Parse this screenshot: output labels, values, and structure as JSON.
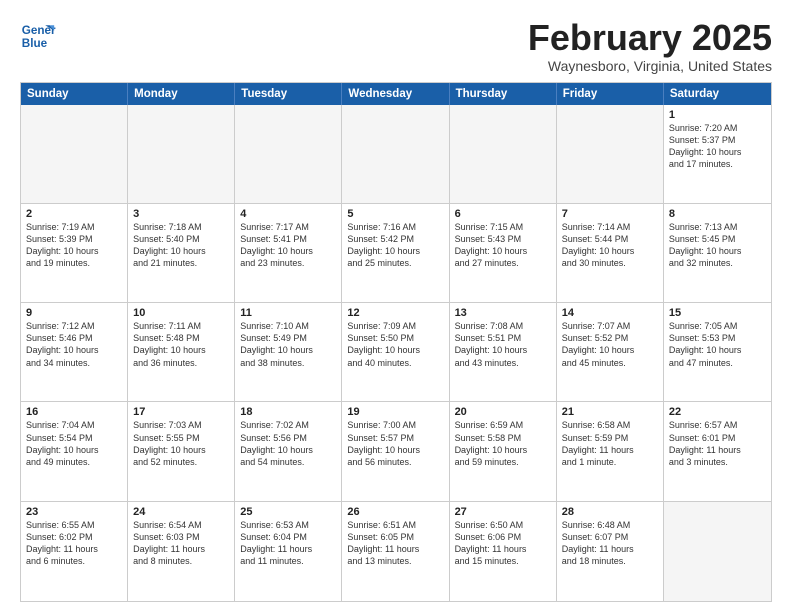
{
  "header": {
    "logo_line1": "General",
    "logo_line2": "Blue",
    "month": "February 2025",
    "location": "Waynesboro, Virginia, United States"
  },
  "weekdays": [
    "Sunday",
    "Monday",
    "Tuesday",
    "Wednesday",
    "Thursday",
    "Friday",
    "Saturday"
  ],
  "weeks": [
    [
      {
        "day": "",
        "info": ""
      },
      {
        "day": "",
        "info": ""
      },
      {
        "day": "",
        "info": ""
      },
      {
        "day": "",
        "info": ""
      },
      {
        "day": "",
        "info": ""
      },
      {
        "day": "",
        "info": ""
      },
      {
        "day": "1",
        "info": "Sunrise: 7:20 AM\nSunset: 5:37 PM\nDaylight: 10 hours\nand 17 minutes."
      }
    ],
    [
      {
        "day": "2",
        "info": "Sunrise: 7:19 AM\nSunset: 5:39 PM\nDaylight: 10 hours\nand 19 minutes."
      },
      {
        "day": "3",
        "info": "Sunrise: 7:18 AM\nSunset: 5:40 PM\nDaylight: 10 hours\nand 21 minutes."
      },
      {
        "day": "4",
        "info": "Sunrise: 7:17 AM\nSunset: 5:41 PM\nDaylight: 10 hours\nand 23 minutes."
      },
      {
        "day": "5",
        "info": "Sunrise: 7:16 AM\nSunset: 5:42 PM\nDaylight: 10 hours\nand 25 minutes."
      },
      {
        "day": "6",
        "info": "Sunrise: 7:15 AM\nSunset: 5:43 PM\nDaylight: 10 hours\nand 27 minutes."
      },
      {
        "day": "7",
        "info": "Sunrise: 7:14 AM\nSunset: 5:44 PM\nDaylight: 10 hours\nand 30 minutes."
      },
      {
        "day": "8",
        "info": "Sunrise: 7:13 AM\nSunset: 5:45 PM\nDaylight: 10 hours\nand 32 minutes."
      }
    ],
    [
      {
        "day": "9",
        "info": "Sunrise: 7:12 AM\nSunset: 5:46 PM\nDaylight: 10 hours\nand 34 minutes."
      },
      {
        "day": "10",
        "info": "Sunrise: 7:11 AM\nSunset: 5:48 PM\nDaylight: 10 hours\nand 36 minutes."
      },
      {
        "day": "11",
        "info": "Sunrise: 7:10 AM\nSunset: 5:49 PM\nDaylight: 10 hours\nand 38 minutes."
      },
      {
        "day": "12",
        "info": "Sunrise: 7:09 AM\nSunset: 5:50 PM\nDaylight: 10 hours\nand 40 minutes."
      },
      {
        "day": "13",
        "info": "Sunrise: 7:08 AM\nSunset: 5:51 PM\nDaylight: 10 hours\nand 43 minutes."
      },
      {
        "day": "14",
        "info": "Sunrise: 7:07 AM\nSunset: 5:52 PM\nDaylight: 10 hours\nand 45 minutes."
      },
      {
        "day": "15",
        "info": "Sunrise: 7:05 AM\nSunset: 5:53 PM\nDaylight: 10 hours\nand 47 minutes."
      }
    ],
    [
      {
        "day": "16",
        "info": "Sunrise: 7:04 AM\nSunset: 5:54 PM\nDaylight: 10 hours\nand 49 minutes."
      },
      {
        "day": "17",
        "info": "Sunrise: 7:03 AM\nSunset: 5:55 PM\nDaylight: 10 hours\nand 52 minutes."
      },
      {
        "day": "18",
        "info": "Sunrise: 7:02 AM\nSunset: 5:56 PM\nDaylight: 10 hours\nand 54 minutes."
      },
      {
        "day": "19",
        "info": "Sunrise: 7:00 AM\nSunset: 5:57 PM\nDaylight: 10 hours\nand 56 minutes."
      },
      {
        "day": "20",
        "info": "Sunrise: 6:59 AM\nSunset: 5:58 PM\nDaylight: 10 hours\nand 59 minutes."
      },
      {
        "day": "21",
        "info": "Sunrise: 6:58 AM\nSunset: 5:59 PM\nDaylight: 11 hours\nand 1 minute."
      },
      {
        "day": "22",
        "info": "Sunrise: 6:57 AM\nSunset: 6:01 PM\nDaylight: 11 hours\nand 3 minutes."
      }
    ],
    [
      {
        "day": "23",
        "info": "Sunrise: 6:55 AM\nSunset: 6:02 PM\nDaylight: 11 hours\nand 6 minutes."
      },
      {
        "day": "24",
        "info": "Sunrise: 6:54 AM\nSunset: 6:03 PM\nDaylight: 11 hours\nand 8 minutes."
      },
      {
        "day": "25",
        "info": "Sunrise: 6:53 AM\nSunset: 6:04 PM\nDaylight: 11 hours\nand 11 minutes."
      },
      {
        "day": "26",
        "info": "Sunrise: 6:51 AM\nSunset: 6:05 PM\nDaylight: 11 hours\nand 13 minutes."
      },
      {
        "day": "27",
        "info": "Sunrise: 6:50 AM\nSunset: 6:06 PM\nDaylight: 11 hours\nand 15 minutes."
      },
      {
        "day": "28",
        "info": "Sunrise: 6:48 AM\nSunset: 6:07 PM\nDaylight: 11 hours\nand 18 minutes."
      },
      {
        "day": "",
        "info": ""
      }
    ]
  ]
}
